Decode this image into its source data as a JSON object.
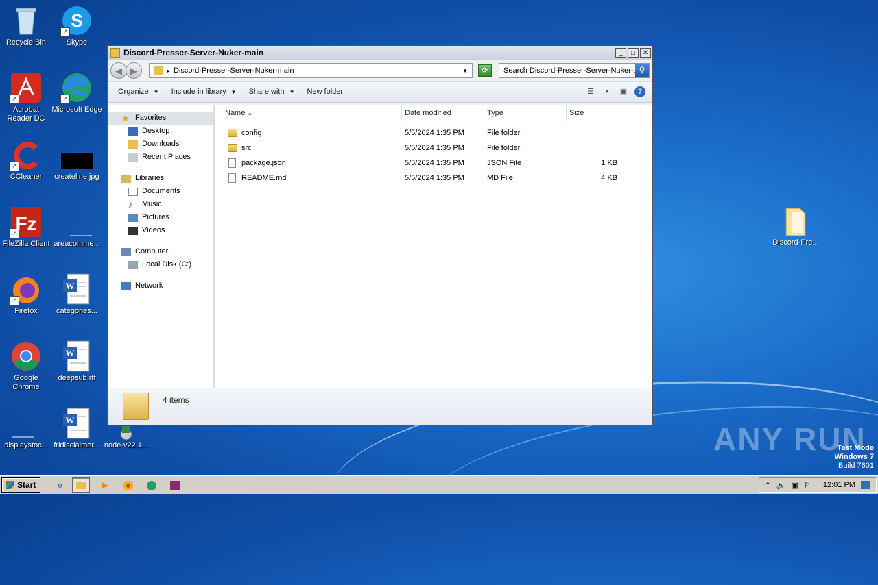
{
  "desktop": {
    "icons": [
      {
        "label": "Recycle Bin",
        "icon": "recycle-bin-icon"
      },
      {
        "label": "Skype",
        "icon": "skype-icon"
      },
      {
        "label": "Acrobat Reader DC",
        "icon": "acrobat-icon"
      },
      {
        "label": "Microsoft Edge",
        "icon": "edge-icon"
      },
      {
        "label": "CCleaner",
        "icon": "ccleaner-icon"
      },
      {
        "label": "createline.jpg",
        "icon": "image-file-icon"
      },
      {
        "label": "FileZilla Client",
        "icon": "filezilla-icon"
      },
      {
        "label": "areacomme...",
        "icon": "file-icon"
      },
      {
        "label": "Firefox",
        "icon": "firefox-icon"
      },
      {
        "label": "categories...",
        "icon": "word-doc-icon"
      },
      {
        "label": "Google Chrome",
        "icon": "chrome-icon"
      },
      {
        "label": "deepsub.rtf",
        "icon": "word-doc-icon"
      },
      {
        "label": "displaystoc...",
        "icon": "file-icon"
      },
      {
        "label": "fridisclaimer...",
        "icon": "word-doc-icon"
      },
      {
        "label": "node-v22.1...",
        "icon": "installer-icon"
      },
      {
        "label": "Discord-Pre...",
        "icon": "folder-icon"
      }
    ]
  },
  "window": {
    "title": "Discord-Presser-Server-Nuker-main",
    "address_path": "Discord-Presser-Server-Nuker-main",
    "search_placeholder": "Search Discord-Presser-Server-Nuker-...",
    "toolbar": {
      "organize": "Organize",
      "include_in_library": "Include in library",
      "share_with": "Share with",
      "new_folder": "New folder"
    },
    "nav": {
      "favorites": "Favorites",
      "desktop": "Desktop",
      "downloads": "Downloads",
      "recent_places": "Recent Places",
      "libraries": "Libraries",
      "documents": "Documents",
      "music": "Music",
      "pictures": "Pictures",
      "videos": "Videos",
      "computer": "Computer",
      "local_disk": "Local Disk (C:)",
      "network": "Network"
    },
    "columns": {
      "name": "Name",
      "date_modified": "Date modified",
      "type": "Type",
      "size": "Size"
    },
    "files": [
      {
        "name": "config",
        "date": "5/5/2024 1:35 PM",
        "type": "File folder",
        "size": ""
      },
      {
        "name": "src",
        "date": "5/5/2024 1:35 PM",
        "type": "File folder",
        "size": ""
      },
      {
        "name": "package.json",
        "date": "5/5/2024 1:35 PM",
        "type": "JSON File",
        "size": "1 KB"
      },
      {
        "name": "README.md",
        "date": "5/5/2024 1:35 PM",
        "type": "MD File",
        "size": "4 KB"
      }
    ],
    "status": "4 items"
  },
  "watermark": {
    "brand": "ANY RUN",
    "test_mode": "Test Mode",
    "os": "Windows 7",
    "build": "Build 7601"
  },
  "taskbar": {
    "start": "Start",
    "clock": "12:01 PM"
  }
}
